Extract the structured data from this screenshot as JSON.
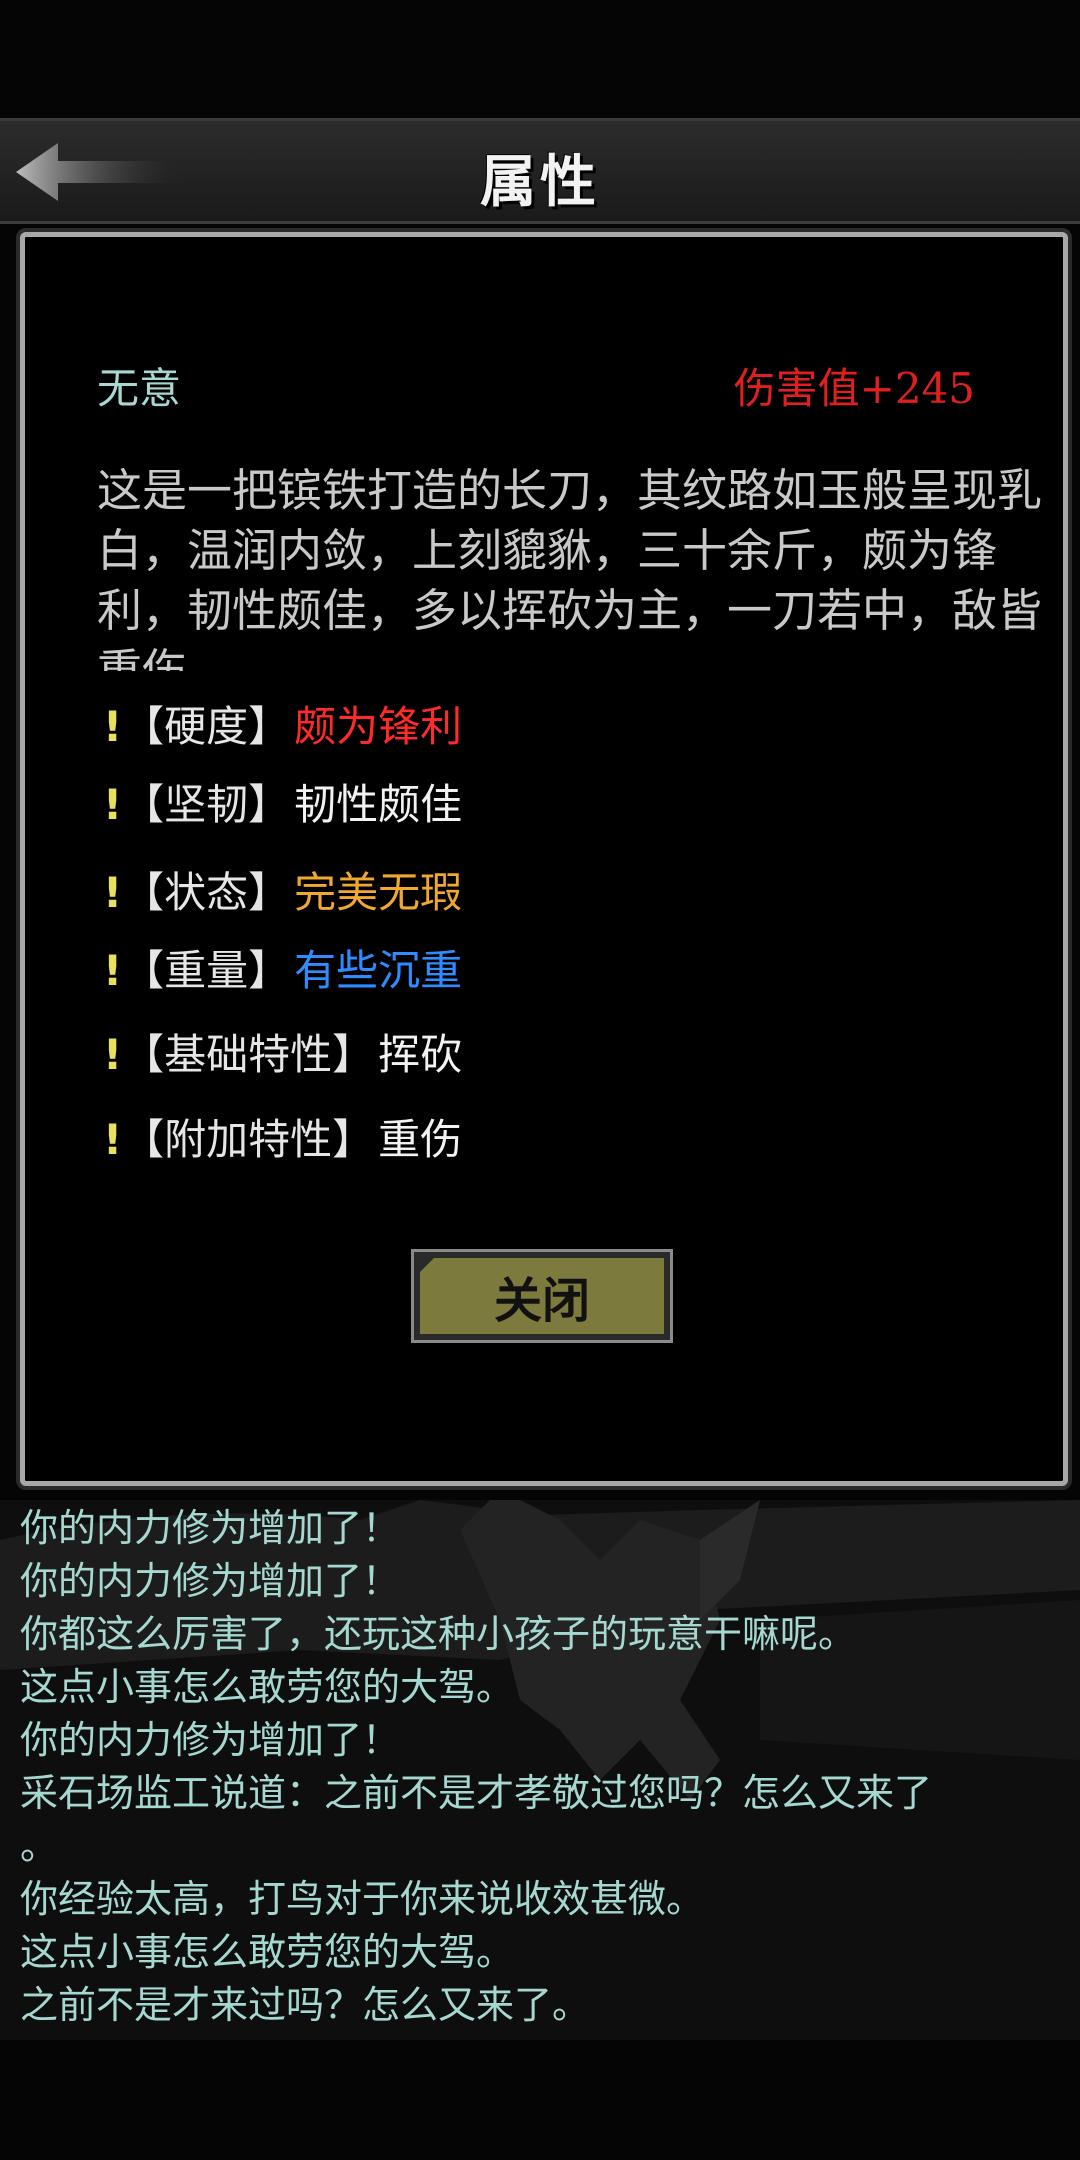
{
  "header": {
    "title": "属性",
    "back_icon": "back-arrow-icon"
  },
  "item": {
    "name": "无意",
    "damage": "伤害值+245",
    "description": "这是一把镔铁打造的长刀，其纹路如玉般呈现乳白，温润内敛，上刻貔貅，三十余斤，颇为锋利，韧性颇佳，多以挥砍为主，一刀若中，敌皆重伤"
  },
  "attributes": [
    {
      "mark": "!",
      "key": "【硬度】",
      "value": "颇为锋利",
      "color": "#ff2a2a"
    },
    {
      "mark": "!",
      "key": "【坚韧】",
      "value": "韧性颇佳",
      "color": "#f2f2f2"
    },
    {
      "mark": "!",
      "key": "【状态】",
      "value": "完美无瑕",
      "color": "#f0a830"
    },
    {
      "mark": "!",
      "key": "【重量】",
      "value": "有些沉重",
      "color": "#2f8cff"
    },
    {
      "mark": "!",
      "key": "【基础特性】",
      "value": "挥砍",
      "color": "#f2f2f2"
    },
    {
      "mark": "!",
      "key": "【附加特性】",
      "value": "重伤",
      "color": "#f2f2f2"
    }
  ],
  "close_button": {
    "label": "关闭"
  },
  "log": [
    "你的内力修为增加了！",
    "你的内力修为增加了！",
    "你都这么厉害了，还玩这种小孩子的玩意干嘛呢。",
    "这点小事怎么敢劳您的大驾。",
    "你的内力修为增加了！",
    "采石场监工说道：之前不是才孝敬过您吗？怎么又来了",
    "。",
    "你经验太高，打鸟对于你来说收效甚微。",
    "这点小事怎么敢劳您的大驾。",
    "之前不是才来过吗？怎么又来了。"
  ]
}
